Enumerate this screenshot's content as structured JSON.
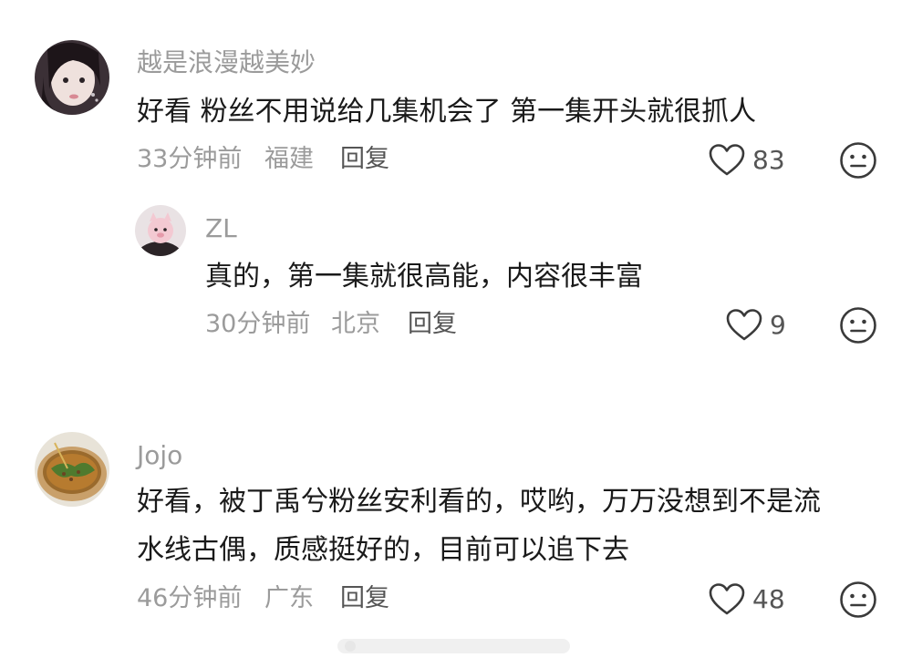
{
  "comments": [
    {
      "username": "越是浪漫越美妙",
      "content_lines": [
        "好看 粉丝不用说给几集机会了 第一集开头就很抓人"
      ],
      "time": "33分钟前",
      "location": "福建",
      "reply_label": "回复",
      "likes": "83",
      "replies": [
        {
          "username": "ZL",
          "content_lines": [
            "真的，第一集就很高能，内容很丰富"
          ],
          "time": "30分钟前",
          "location": "北京",
          "reply_label": "回复",
          "likes": "9"
        }
      ]
    },
    {
      "username": "Jojo",
      "content_lines": [
        "好看，被丁禹兮粉丝安利看的，哎哟，万万没想到不是流",
        "水线古偶，质感挺好的，目前可以追下去"
      ],
      "time": "46分钟前",
      "location": "广东",
      "reply_label": "回复",
      "likes": "48"
    }
  ],
  "icons": {
    "like": "heart-outline-icon",
    "dislike": "neutral-face-icon"
  },
  "colors": {
    "username": "#9b9b9b",
    "content": "#1a1a1a",
    "meta": "#9b9b9b",
    "icon": "#3a3a3a"
  }
}
